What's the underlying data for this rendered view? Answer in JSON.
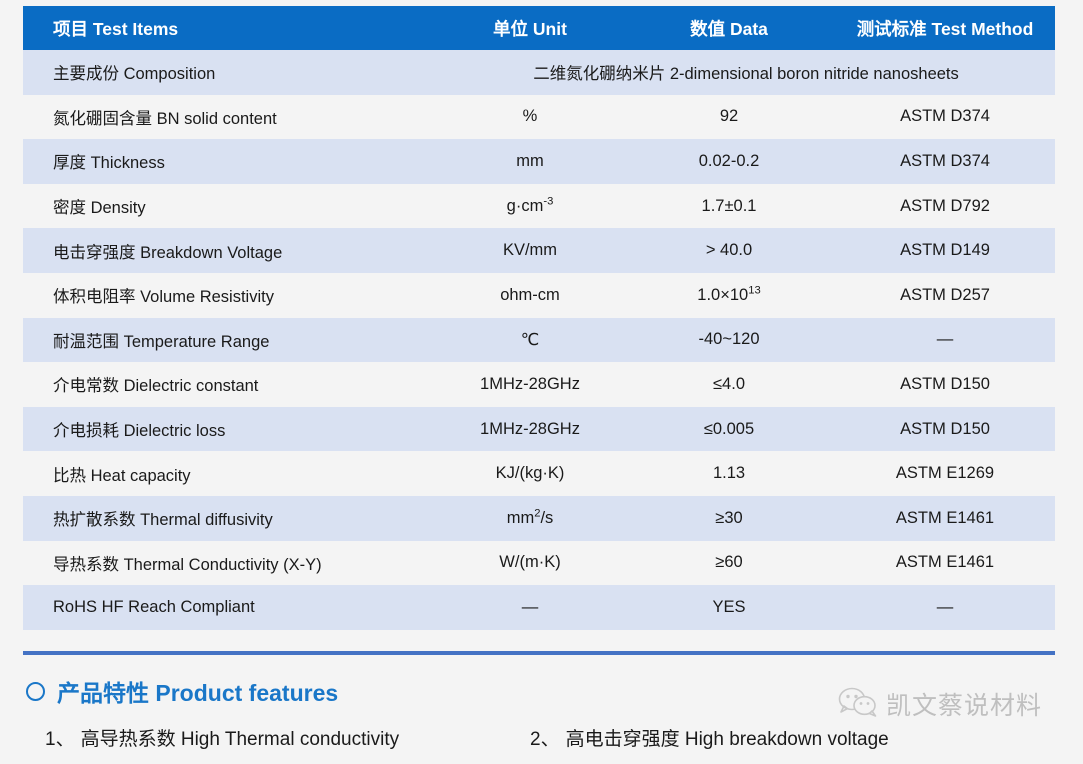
{
  "table": {
    "headers": {
      "item": "项目  Test  Items",
      "unit": "单位  Unit",
      "data": "数值 Data",
      "method": "测试标准 Test  Method"
    },
    "rows": [
      {
        "item": "主要成份   Composition",
        "merged": "二维氮化硼纳米片  2-dimensional boron nitride nanosheets"
      },
      {
        "item": "氮化硼固含量 BN solid content",
        "unit": "%",
        "data": "92",
        "method": "ASTM D374"
      },
      {
        "item": "厚度 Thickness",
        "unit": "mm",
        "data": "0.02-0.2",
        "method": "ASTM D374"
      },
      {
        "item": "密度 Density",
        "unit": "g·cm",
        "unit_sup": "-3",
        "data": "1.7±0.1",
        "method": "ASTM D792"
      },
      {
        "item": "电击穿强度 Breakdown Voltage",
        "unit": "KV/mm",
        "data": "> 40.0",
        "method": "ASTM D149"
      },
      {
        "item": "体积电阻率 Volume Resistivity",
        "unit": "ohm-cm",
        "data": "1.0×10",
        "data_sup": "13",
        "method": "ASTM D257"
      },
      {
        "item": "耐温范围 Temperature Range",
        "unit": "℃",
        "data": "-40~120",
        "method": "—"
      },
      {
        "item": "介电常数 Dielectric constant",
        "unit": "1MHz-28GHz",
        "data": "≤4.0",
        "method": "ASTM  D150"
      },
      {
        "item": "介电损耗 Dielectric loss",
        "unit": "1MHz-28GHz",
        "data": "≤0.005",
        "method": "ASTM  D150"
      },
      {
        "item": "比热 Heat capacity",
        "unit": "KJ/(kg·K)",
        "data": "1.13",
        "method": "ASTM E1269"
      },
      {
        "item": "热扩散系数 Thermal diffusivity",
        "unit": "mm",
        "unit_sup": "2",
        "unit_tail": "/s",
        "data": "≥30",
        "method": "ASTM E1461"
      },
      {
        "item": "导热系数  Thermal Conductivity  (X-Y)",
        "unit": "W/(m·K)",
        "data": "≥60",
        "method": "ASTM E1461"
      },
      {
        "item": "RoHS  HF   Reach Compliant",
        "unit": "—",
        "data": "YES",
        "method": "—"
      }
    ]
  },
  "features": {
    "heading": "产品特性 Product features",
    "items": [
      {
        "num": "1、",
        "text": "高导热系数  High  Thermal conductivity"
      },
      {
        "num": "2、",
        "text": "高电击穿强度 High breakdown voltage"
      }
    ]
  },
  "watermark": {
    "text": "凯文蔡说材料"
  },
  "colors": {
    "header_blue": "#0a6cc4",
    "row_alt": "#d9e1f2",
    "row_plain": "#f4f4f4",
    "rule_blue": "#4472c4",
    "accent_blue": "#1a77c8"
  }
}
